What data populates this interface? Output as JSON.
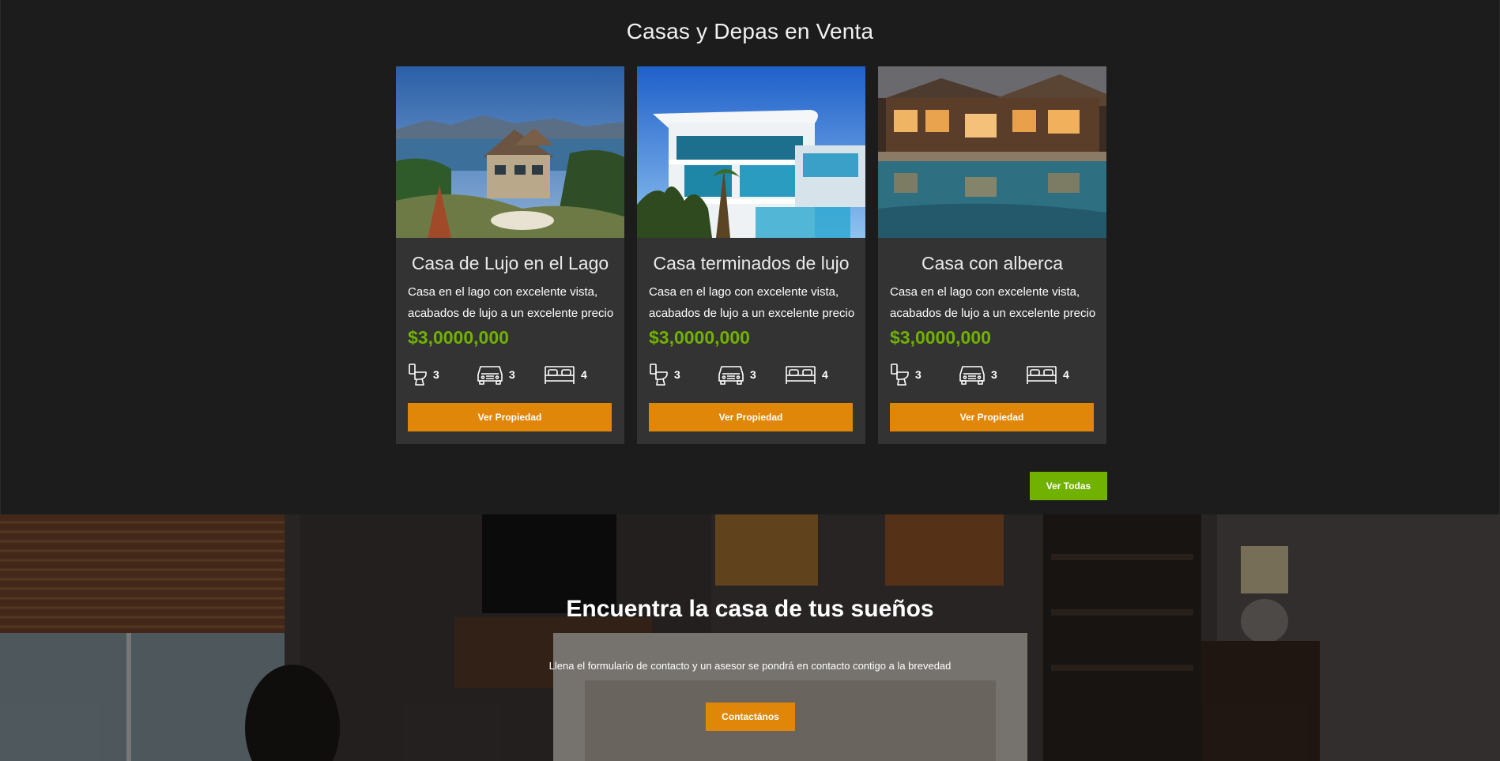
{
  "listings": {
    "title": "Casas y Depas en Venta",
    "cards": [
      {
        "title": "Casa de Lujo en el Lago",
        "description": "Casa en el lago con excelente vista, acabados de lujo a un excelente precio",
        "price": "$3,0000,000",
        "bathrooms": "3",
        "parking": "3",
        "bedrooms": "4",
        "button": "Ver Propiedad"
      },
      {
        "title": "Casa terminados de lujo",
        "description": "Casa en el lago con excelente vista, acabados de lujo a un excelente precio",
        "price": "$3,0000,000",
        "bathrooms": "3",
        "parking": "3",
        "bedrooms": "4",
        "button": "Ver Propiedad"
      },
      {
        "title": "Casa con alberca",
        "description": "Casa en el lago con excelente vista, acabados de lujo a un excelente precio",
        "price": "$3,0000,000",
        "bathrooms": "3",
        "parking": "3",
        "bedrooms": "4",
        "button": "Ver Propiedad"
      }
    ],
    "view_all": "Ver Todas"
  },
  "cta": {
    "heading": "Encuentra la casa de tus sueños",
    "text": "Llena el formulario de contacto y un asesor se pondrá en contacto contigo a la brevedad",
    "button": "Contactános"
  },
  "colors": {
    "accent_orange": "#e08709",
    "accent_green": "#71b100",
    "card_bg": "#333333",
    "page_bg": "#1c1c1c"
  },
  "icons": [
    "toilet-icon",
    "car-icon",
    "bed-icon"
  ]
}
